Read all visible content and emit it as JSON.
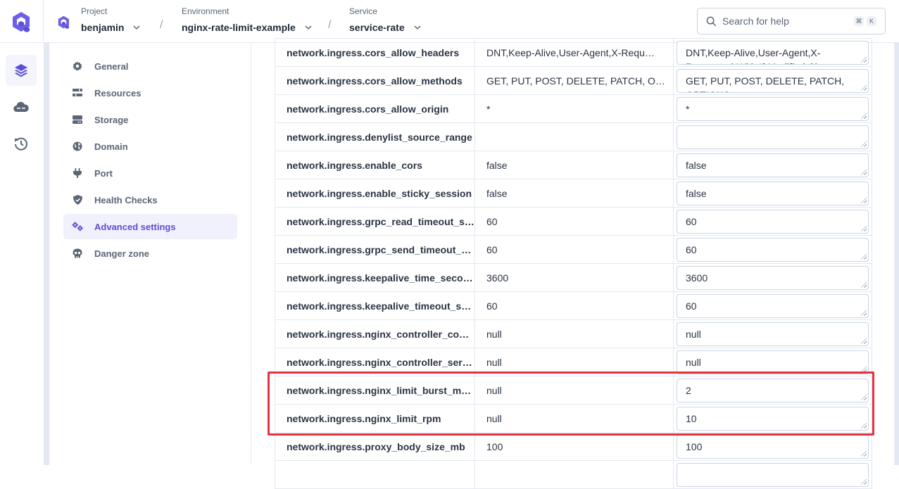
{
  "header": {
    "breadcrumbs": [
      {
        "label": "Project",
        "value": "benjamin"
      },
      {
        "label": "Environment",
        "value": "nginx-rate-limit-example"
      },
      {
        "label": "Service",
        "value": "service-rate"
      }
    ],
    "separator": "/",
    "search": {
      "placeholder": "Search for help",
      "shortcut_keys": [
        "⌘",
        "K"
      ]
    }
  },
  "rail": {
    "items": [
      {
        "icon": "layers-icon",
        "active": true
      },
      {
        "icon": "cloud-server-icon",
        "active": false
      },
      {
        "icon": "history-icon",
        "active": false
      }
    ]
  },
  "sidebar": {
    "items": [
      {
        "label": "General",
        "icon": "gear-icon",
        "active": false
      },
      {
        "label": "Resources",
        "icon": "sliders-icon",
        "active": false
      },
      {
        "label": "Storage",
        "icon": "hard-drive-icon",
        "active": false
      },
      {
        "label": "Domain",
        "icon": "globe-icon",
        "active": false
      },
      {
        "label": "Port",
        "icon": "plug-icon",
        "active": false
      },
      {
        "label": "Health Checks",
        "icon": "shield-check-icon",
        "active": false
      },
      {
        "label": "Advanced settings",
        "icon": "gears-icon",
        "active": true
      },
      {
        "label": "Danger zone",
        "icon": "skull-icon",
        "active": false
      }
    ]
  },
  "settings": {
    "rows": [
      {
        "key": "network.ingress.cors_allow_headers",
        "current": "DNT,Keep-Alive,User-Agent,X-Requ…",
        "value": "DNT,Keep-Alive,User-Agent,X-Requested-With,If-Modified-Since"
      },
      {
        "key": "network.ingress.cors_allow_methods",
        "current": "GET, PUT, POST, DELETE, PATCH, O…",
        "value": "GET, PUT, POST, DELETE, PATCH, OPTIONS"
      },
      {
        "key": "network.ingress.cors_allow_origin",
        "current": "*",
        "value": "*"
      },
      {
        "key": "network.ingress.denylist_source_range",
        "current": "",
        "value": ""
      },
      {
        "key": "network.ingress.enable_cors",
        "current": "false",
        "value": "false"
      },
      {
        "key": "network.ingress.enable_sticky_session",
        "current": "false",
        "value": "false"
      },
      {
        "key": "network.ingress.grpc_read_timeout_s…",
        "current": "60",
        "value": "60"
      },
      {
        "key": "network.ingress.grpc_send_timeout_s…",
        "current": "60",
        "value": "60"
      },
      {
        "key": "network.ingress.keepalive_time_seco…",
        "current": "3600",
        "value": "3600"
      },
      {
        "key": "network.ingress.keepalive_timeout_s…",
        "current": "60",
        "value": "60"
      },
      {
        "key": "network.ingress.nginx_controller_con…",
        "current": "null",
        "value": "null"
      },
      {
        "key": "network.ingress.nginx_controller_serv…",
        "current": "null",
        "value": "null"
      },
      {
        "key": "network.ingress.nginx_limit_burst_mu…",
        "current": "null",
        "value": "2"
      },
      {
        "key": "network.ingress.nginx_limit_rpm",
        "current": "null",
        "value": "10"
      },
      {
        "key": "network.ingress.proxy_body_size_mb",
        "current": "100",
        "value": "100"
      },
      {
        "key": "",
        "current": "",
        "value": ""
      }
    ]
  },
  "colors": {
    "accent": "#5b4fd6",
    "highlight": "#e8313f"
  }
}
